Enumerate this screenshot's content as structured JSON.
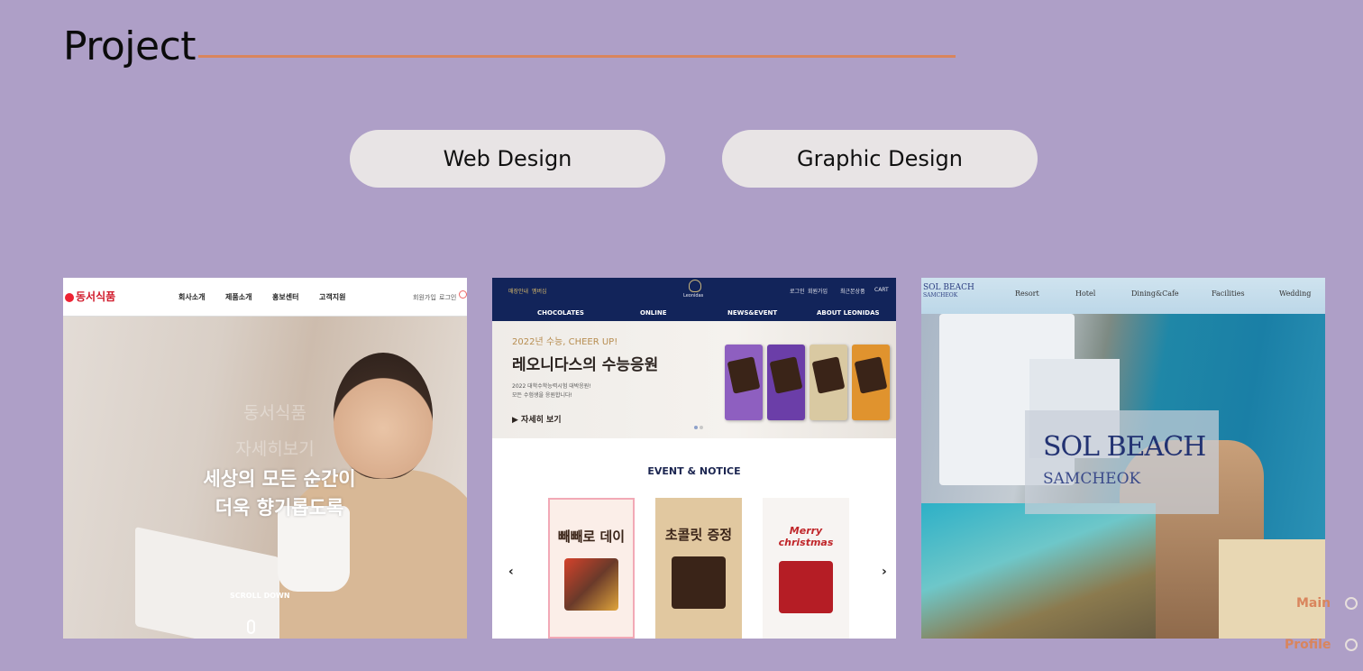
{
  "header": {
    "title": "Project"
  },
  "categories": [
    {
      "label": "Web Design"
    },
    {
      "label": "Graphic Design"
    }
  ],
  "projects": [
    {
      "brand": "동서식품",
      "nav": [
        "회사소개",
        "제품소개",
        "홍보센터",
        "고객지원"
      ],
      "utility": [
        "회원가입",
        "로그인"
      ],
      "hero_ghost": [
        "동서식품",
        "자세히보기"
      ],
      "hero_text": [
        "세상의 모든 순간이",
        "더욱 향기롭도록"
      ],
      "scroll": "SCROLL DOWN"
    },
    {
      "top_left": [
        "매장안내",
        "멤버십"
      ],
      "top_right": [
        "로그인",
        "회원가입",
        "최근본상품",
        "CART"
      ],
      "brand": "Leonidas",
      "nav": [
        "CHOCOLATES",
        "ONLINE",
        "NEWS&EVENT",
        "ABOUT LEONIDAS"
      ],
      "banner_kicker": "2022년 수능, CHEER UP!",
      "banner_title": "레오니다스의 수능응원",
      "banner_desc": [
        "2022 대학수학능력시험 대박응원!",
        "모든 수험생을 응원합니다!"
      ],
      "banner_cta": "▶ 자세히 보기",
      "event_title": "EVENT & NOTICE",
      "event_cards": [
        {
          "title": "빼빼로 데이"
        },
        {
          "title": "초콜릿 증정"
        },
        {
          "title": "Merry christmas"
        }
      ],
      "arrow_prev": "‹",
      "arrow_next": "›"
    },
    {
      "logo_line1": "SOL BEACH",
      "logo_line2": "SAMCHEOK",
      "nav": [
        "Resort",
        "Hotel",
        "Dining&Cafe",
        "Facilities",
        "Wedding"
      ],
      "title": "SOL BEACH",
      "subtitle": "SAMCHEOK"
    }
  ],
  "side_nav": [
    {
      "label": "Main"
    },
    {
      "label": "Profile"
    }
  ],
  "colors": {
    "background": "#ae9fc7",
    "accent": "#d9855d",
    "button_bg": "#e8e4e5"
  }
}
